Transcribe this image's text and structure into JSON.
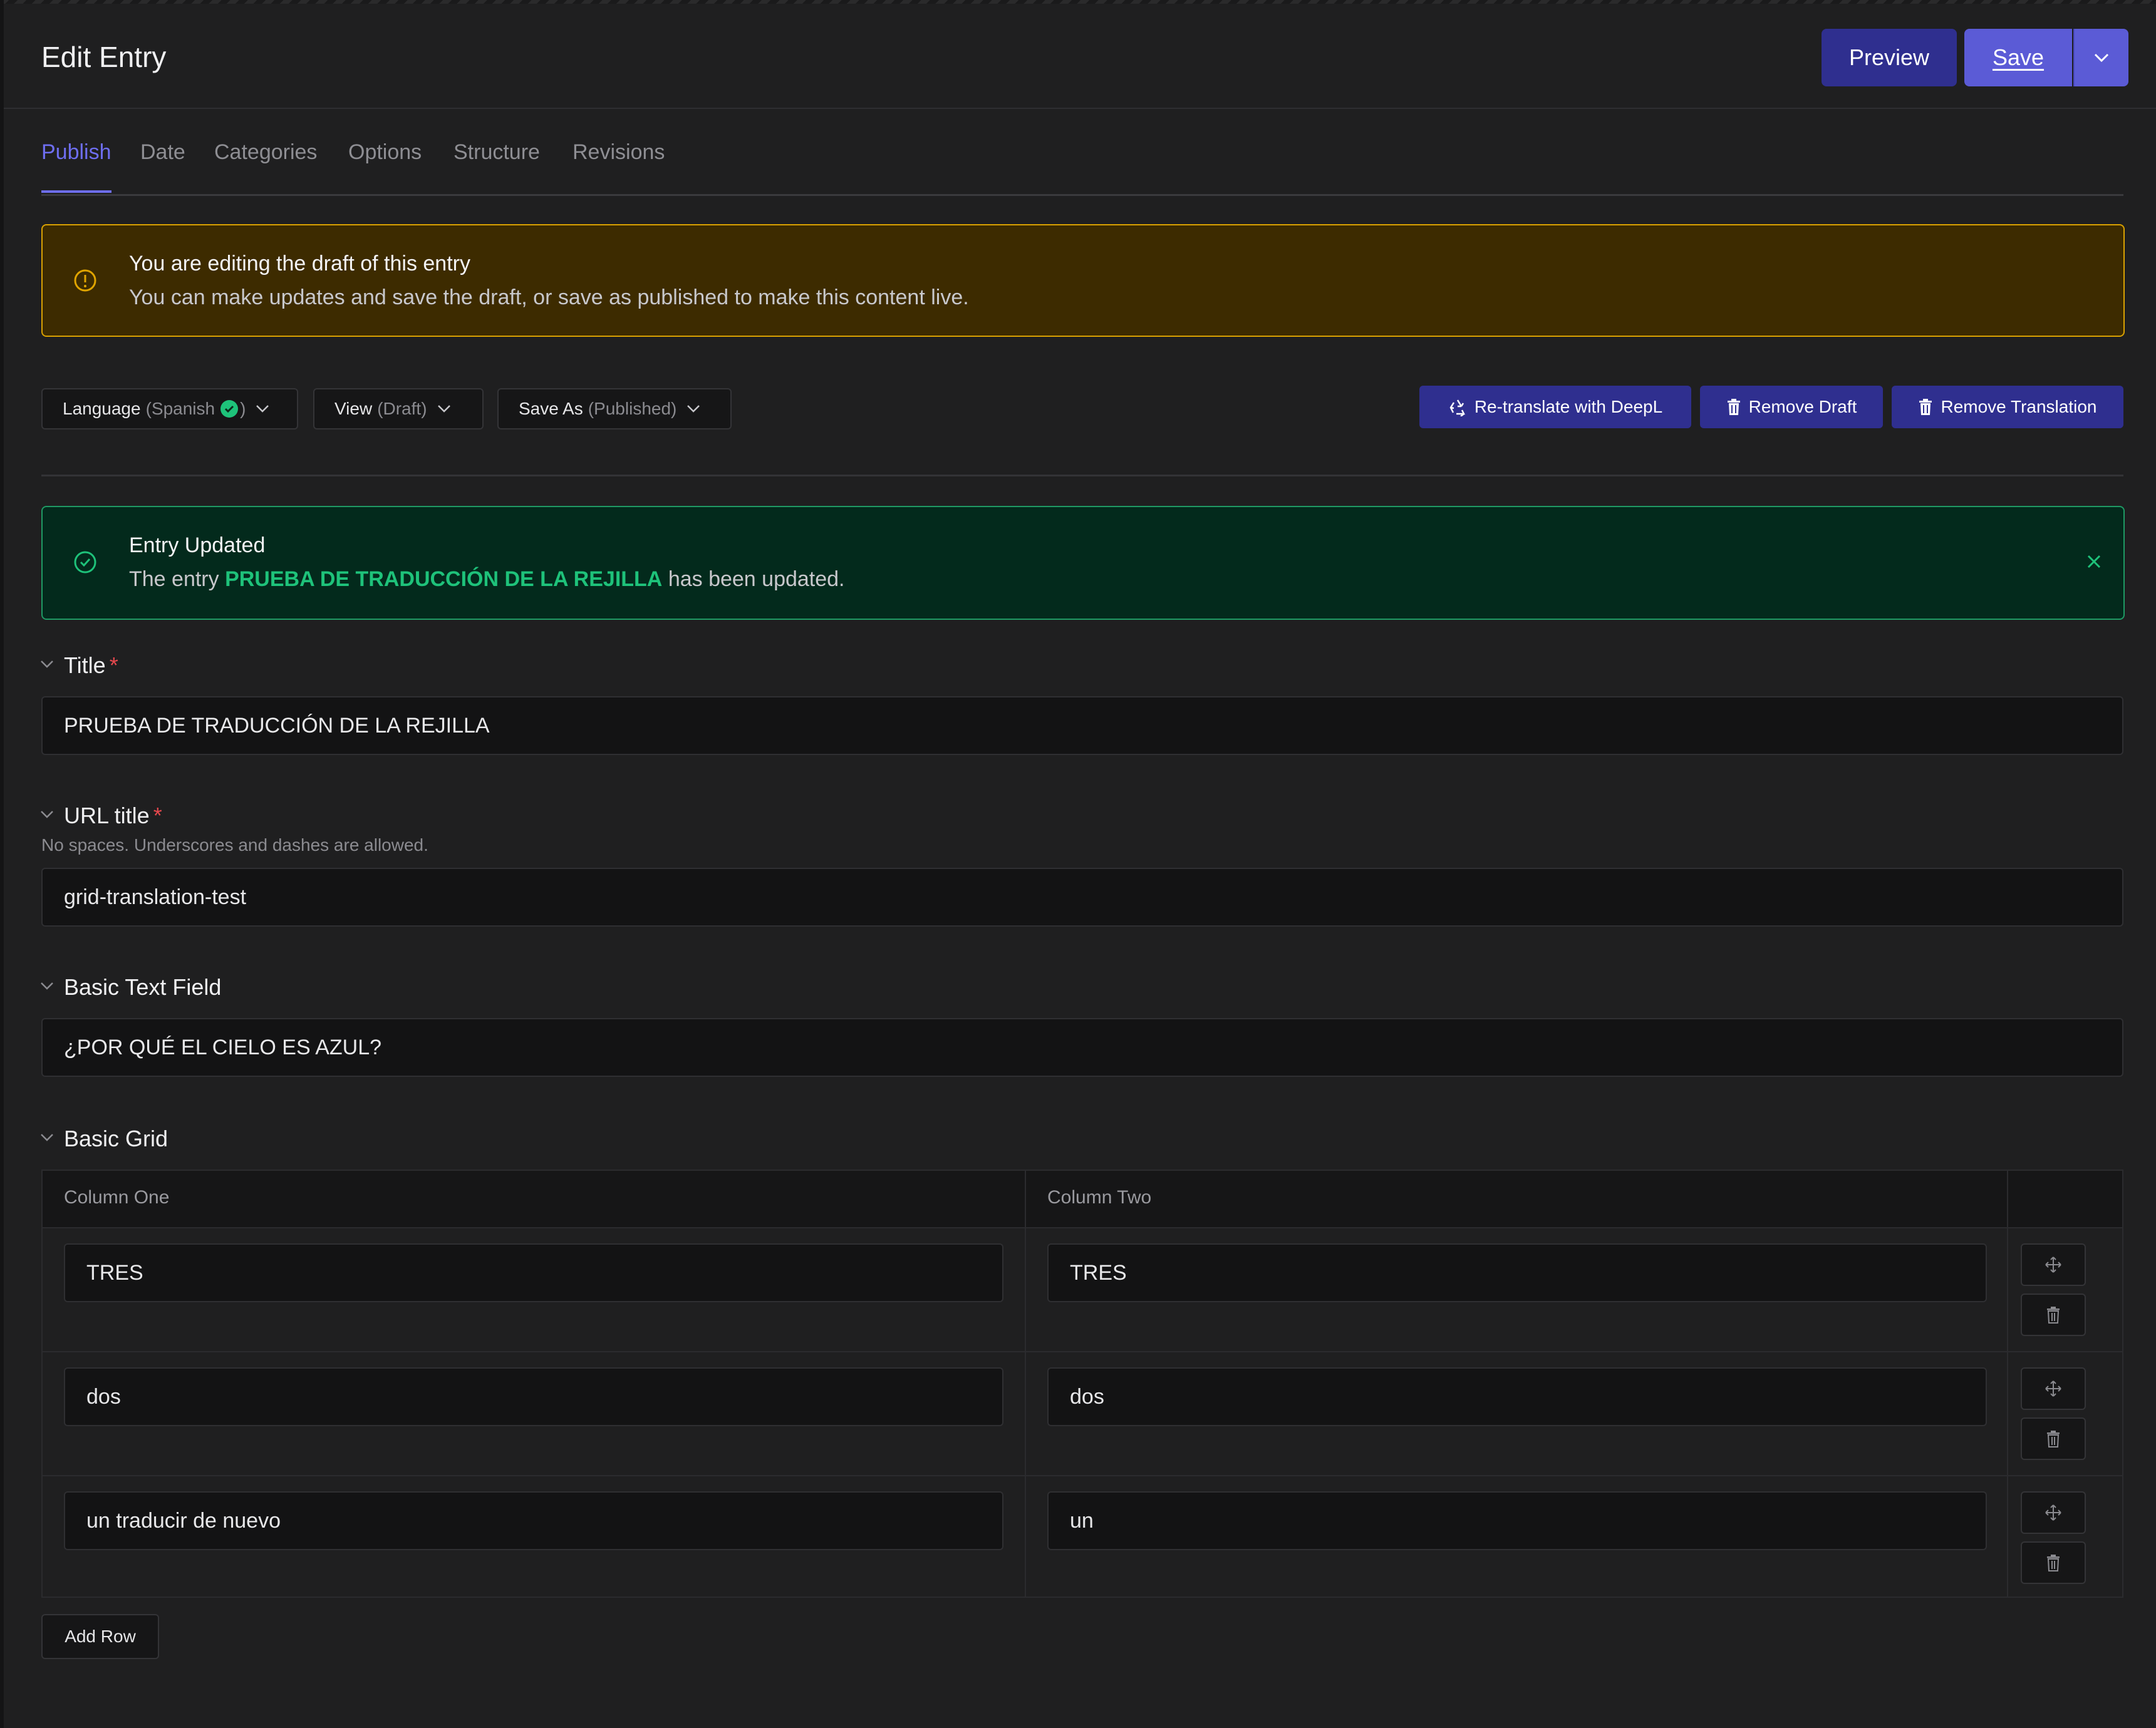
{
  "header": {
    "title": "Edit Entry",
    "preview_label": "Preview",
    "save_label": "Save"
  },
  "tabs": [
    {
      "label": "Publish",
      "active": true
    },
    {
      "label": "Date"
    },
    {
      "label": "Categories"
    },
    {
      "label": "Options"
    },
    {
      "label": "Structure"
    },
    {
      "label": "Revisions"
    }
  ],
  "draft_alert": {
    "title": "You are editing the draft of this entry",
    "description": "You can make updates and save the draft, or save as published to make this content live."
  },
  "toolbar": {
    "language": {
      "label": "Language",
      "value": "(Spanish",
      "suffix": ")"
    },
    "view": {
      "label": "View",
      "value": "(Draft)"
    },
    "save_as": {
      "label": "Save As",
      "value": "(Published)"
    },
    "retranslate_label": "Re-translate with DeepL",
    "remove_draft_label": "Remove Draft",
    "remove_translation_label": "Remove Translation"
  },
  "success_alert": {
    "title": "Entry Updated",
    "prefix": "The entry",
    "entry_name": "PRUEBA DE TRADUCCIÓN DE LA REJILLA",
    "suffix": "has been updated."
  },
  "fields": {
    "title": {
      "label": "Title",
      "value": "PRUEBA DE TRADUCCIÓN DE LA REJILLA"
    },
    "url_title": {
      "label": "URL title",
      "hint": "No spaces. Underscores and dashes are allowed.",
      "value": "grid-translation-test"
    },
    "basic_text": {
      "label": "Basic Text Field",
      "value": "¿POR QUÉ EL CIELO ES AZUL?"
    },
    "basic_grid": {
      "label": "Basic Grid",
      "columns": [
        "Column One",
        "Column Two"
      ],
      "rows": [
        [
          "TRES",
          "TRES"
        ],
        [
          "dos",
          "dos"
        ],
        [
          "un traducir de nuevo",
          "un"
        ]
      ],
      "add_row_label": "Add Row"
    }
  },
  "colors": {
    "accent": "#5b5bd6",
    "warning_bg": "#3d2b00",
    "warning_border": "#d9a100",
    "success_bg": "#032a1c",
    "success_border": "#1f9a64",
    "success_text": "#1ec27a",
    "required": "#e5484d"
  },
  "icons": [
    "chevron-down-icon",
    "alert-circle-icon",
    "check-circle-icon",
    "recycle-icon",
    "trash-icon",
    "close-icon",
    "move-icon"
  ]
}
